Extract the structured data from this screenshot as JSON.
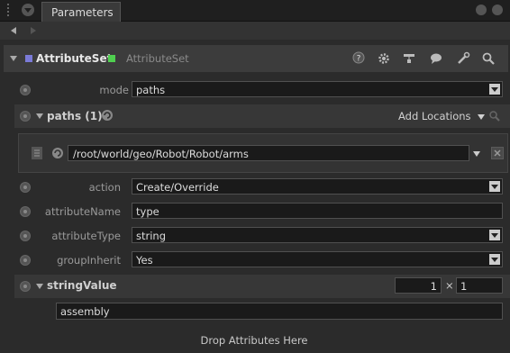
{
  "panel": {
    "tab_label": "Parameters"
  },
  "node": {
    "name": "AttributeSet",
    "type": "AttributeSet",
    "colors": {
      "node_square": "#7b7bd8",
      "state_square": "#4fcf4f"
    },
    "toolbar_icons": [
      "help-icon",
      "gear-icon",
      "layout-icon",
      "comment-icon",
      "wrench-icon",
      "search-icon"
    ]
  },
  "params": {
    "mode": {
      "label": "mode",
      "value": "paths"
    },
    "paths": {
      "title": "paths (1)",
      "add_locations_label": "Add Locations",
      "entries": [
        "/root/world/geo/Robot/Robot/arms"
      ]
    },
    "action": {
      "label": "action",
      "value": "Create/Override"
    },
    "attributeName": {
      "label": "attributeName",
      "value": "type"
    },
    "attributeType": {
      "label": "attributeType",
      "value": "string"
    },
    "groupInherit": {
      "label": "groupInherit",
      "value": "Yes"
    },
    "stringValue": {
      "title": "stringValue",
      "rows": "1",
      "times": "×",
      "cols": "1",
      "value": "assembly"
    }
  },
  "drop_zone": {
    "label": "Drop Attributes Here"
  }
}
